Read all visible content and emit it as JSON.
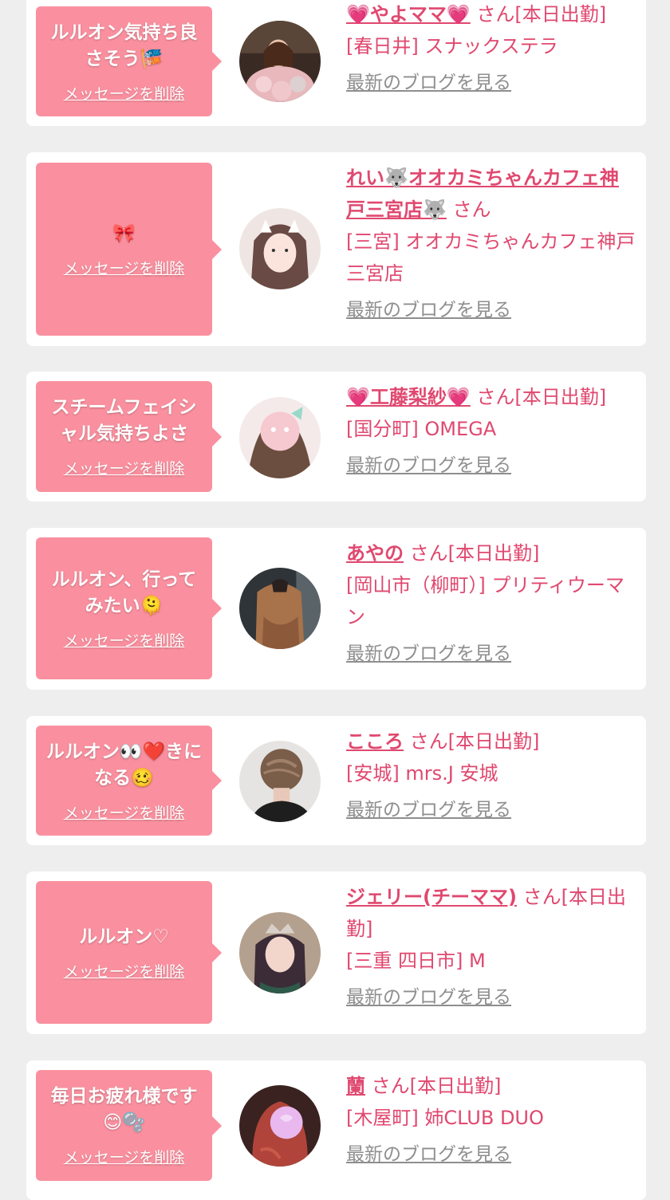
{
  "items": [
    {
      "message": "ルルオン気持ち良さそう🎏",
      "delete_label": "メッセージを削除",
      "name": "💗やよママ💗",
      "suffix": " さん[本日出勤]",
      "shop": "[春日井] スナックステラ",
      "blog_label": "最新のブログを見る",
      "avatar_desc": "woman-with-flowers"
    },
    {
      "message": "🎀",
      "delete_label": "メッセージを削除",
      "name": "れい🐺オオカミちゃんカフェ神戸三宮店🐺",
      "suffix": " さん",
      "shop": "[三宮] オオカミちゃんカフェ神戸三宮店",
      "blog_label": "最新のブログを見る",
      "avatar_desc": "woman-cat-ears"
    },
    {
      "message": "スチームフェイシャル気持ちよさ",
      "delete_label": "メッセージを削除",
      "name": "💗工藤梨紗💗",
      "suffix": " さん[本日出勤]",
      "shop": "[国分町] OMEGA",
      "blog_label": "最新のブログを見る",
      "avatar_desc": "woman-sticker-face"
    },
    {
      "message": "ルルオン、行ってみたい🫠",
      "delete_label": "メッセージを削除",
      "name": "あやの",
      "suffix": " さん[本日出勤]",
      "shop": "[岡山市（柳町）] プリティウーマン",
      "blog_label": "最新のブログを見る",
      "avatar_desc": "woman-hair-back"
    },
    {
      "message": "ルルオン👀❤️きになる🥴",
      "delete_label": "メッセージを削除",
      "name": "こころ",
      "suffix": " さん[本日出勤]",
      "shop": "[安城] mrs.J 安城",
      "blog_label": "最新のブログを見る",
      "avatar_desc": "woman-updo-back"
    },
    {
      "message": "ルルオン♡",
      "delete_label": "メッセージを削除",
      "name": "ジェリー(チーママ)",
      "suffix": " さん[本日出勤]",
      "shop": "[三重 四日市] M",
      "blog_label": "最新のブログを見る",
      "avatar_desc": "woman-tiara"
    },
    {
      "message": "毎日お疲れ様です😊🫧",
      "delete_label": "メッセージを削除",
      "name": "蘭",
      "suffix": " さん[本日出勤]",
      "shop": "[木屋町] 姉CLUB DUO",
      "blog_label": "最新のブログを見る",
      "avatar_desc": "woman-red-hair"
    }
  ],
  "colors": {
    "bubble": "#fa909f",
    "accent": "#e0486f",
    "link_gray": "#8e8e8e",
    "background": "#eeeeee"
  }
}
